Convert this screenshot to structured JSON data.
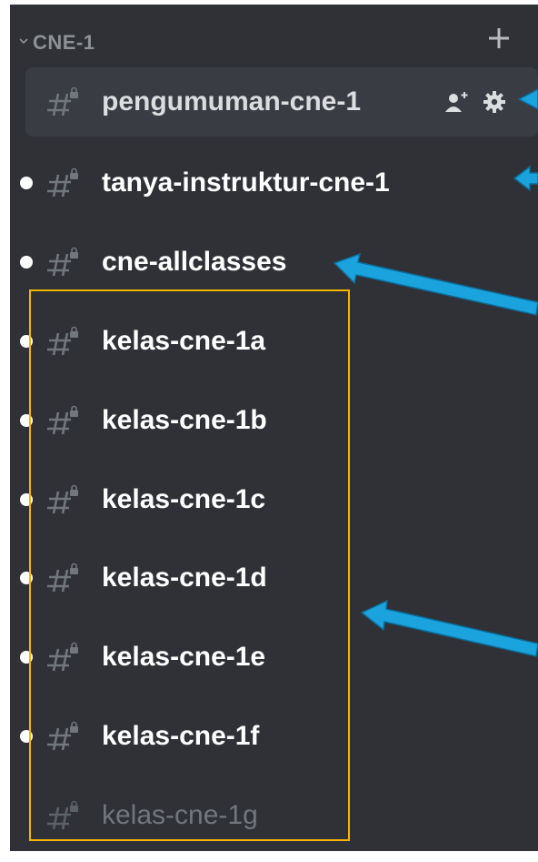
{
  "category": {
    "label": "CNE-1",
    "collapse_icon": "chevron-down-icon",
    "add_icon": "plus-icon"
  },
  "channels": [
    {
      "name": "pengumuman-cne-1",
      "icon": "locked-hash-icon",
      "state": "selected"
    },
    {
      "name": "tanya-instruktur-cne-1",
      "icon": "locked-hash-icon",
      "state": "unread"
    },
    {
      "name": "cne-allclasses",
      "icon": "locked-hash-icon",
      "state": "unread"
    },
    {
      "name": "kelas-cne-1a",
      "icon": "locked-hash-icon",
      "state": "unread"
    },
    {
      "name": "kelas-cne-1b",
      "icon": "locked-hash-icon",
      "state": "unread"
    },
    {
      "name": "kelas-cne-1c",
      "icon": "locked-hash-icon",
      "state": "unread"
    },
    {
      "name": "kelas-cne-1d",
      "icon": "locked-hash-icon",
      "state": "unread"
    },
    {
      "name": "kelas-cne-1e",
      "icon": "locked-hash-icon",
      "state": "unread"
    },
    {
      "name": "kelas-cne-1f",
      "icon": "locked-hash-icon",
      "state": "unread"
    },
    {
      "name": "kelas-cne-1g",
      "icon": "locked-hash-icon",
      "state": "muted"
    }
  ],
  "selected_channel_actions": [
    "create-invite-icon",
    "gear-icon"
  ],
  "colors": {
    "sidebar_bg": "#2f3136",
    "selected_bg": "#393c43",
    "annotation_arrow": "#1aa3dd",
    "highlight_box": "#f7b500"
  }
}
